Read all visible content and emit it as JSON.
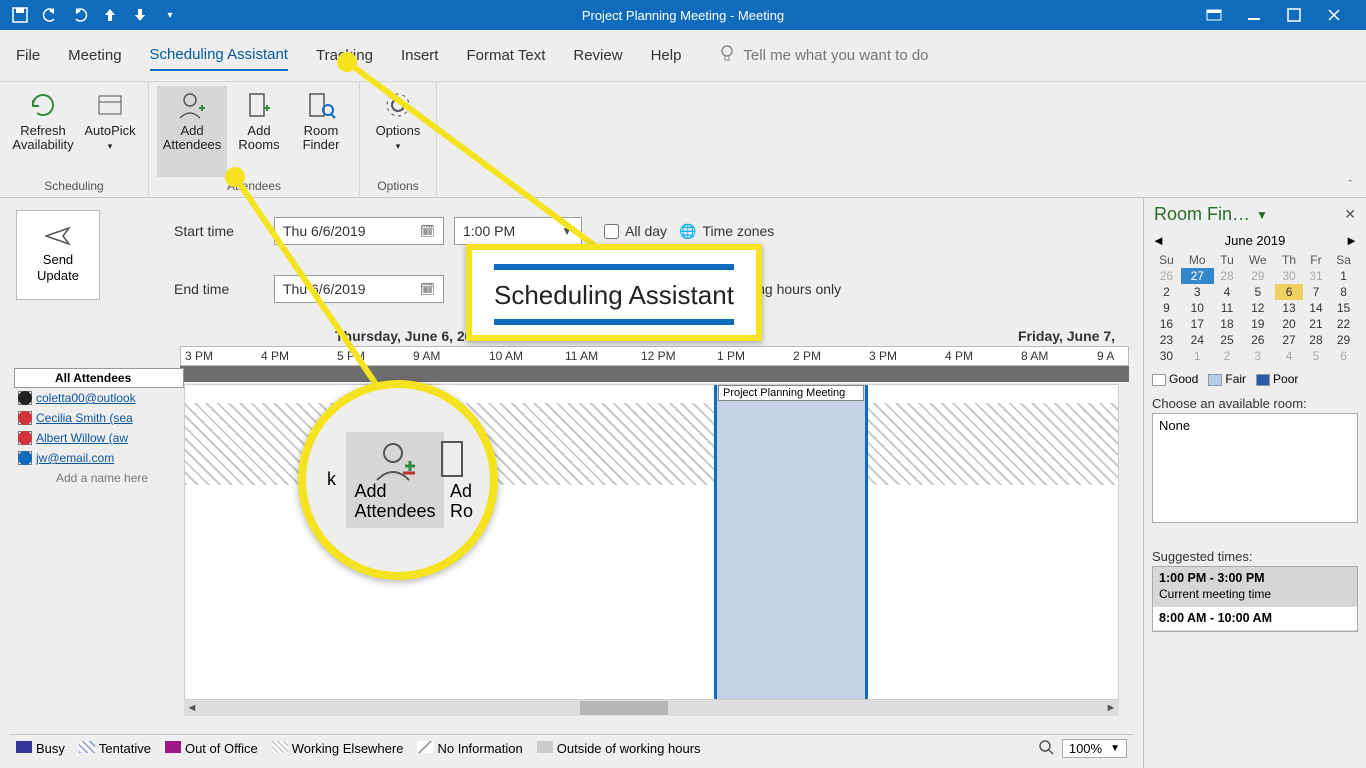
{
  "title_bar": {
    "title": "Project Planning Meeting  -  Meeting"
  },
  "tabs": {
    "file": "File",
    "meeting": "Meeting",
    "scheduling": "Scheduling Assistant",
    "tracking": "Tracking",
    "insert": "Insert",
    "format": "Format Text",
    "review": "Review",
    "help": "Help",
    "tellme": "Tell me what you want to do"
  },
  "ribbon": {
    "scheduling_group": "Scheduling",
    "attendees_group": "Attendees",
    "options_group": "Options",
    "refresh": "Refresh\nAvailability",
    "autopick": "AutoPick",
    "add_attendees": "Add\nAttendees",
    "add_rooms": "Add\nRooms",
    "room_finder": "Room\nFinder",
    "options": "Options"
  },
  "send_update": "Send\nUpdate",
  "time_form": {
    "start_label": "Start time",
    "end_label": "End time",
    "start_date": "Thu 6/6/2019",
    "end_date": "Thu 6/6/2019",
    "start_time": "1:00 PM",
    "all_day": "All day",
    "time_zones": "Time zones",
    "working_hours": "ing hours only"
  },
  "schedule": {
    "day1": "Thursday, June 6, 2019",
    "day2": "Friday, June 7,",
    "hours": [
      "3 PM",
      "4 PM",
      "5 PM",
      "9 AM",
      "10 AM",
      "11 AM",
      "12 PM",
      "1 PM",
      "2 PM",
      "3 PM",
      "4 PM",
      "8 AM",
      "9 A"
    ],
    "meeting_label": "Project Planning Meeting"
  },
  "attendees": {
    "header": "All Attendees",
    "add_hint": "Add a name here",
    "rows": [
      {
        "name": "coletta00@outlook",
        "color": "#222"
      },
      {
        "name": "Cecilia Smith (sea",
        "color": "#d13438"
      },
      {
        "name": "Albert Willow (aw",
        "color": "#d13438"
      },
      {
        "name": "jw@email.com",
        "color": "#0f6cbd"
      }
    ]
  },
  "legend": {
    "busy": "Busy",
    "tentative": "Tentative",
    "ooo": "Out of Office",
    "working_elsewhere": "Working Elsewhere",
    "no_info": "No Information",
    "outside": "Outside of working hours",
    "zoom": "100%"
  },
  "room_finder": {
    "title": "Room Fin…",
    "month": "June 2019",
    "dow": [
      "Su",
      "Mo",
      "Tu",
      "We",
      "Th",
      "Fr",
      "Sa"
    ],
    "weeks": [
      [
        "26",
        "27",
        "28",
        "29",
        "30",
        "31",
        "1"
      ],
      [
        "2",
        "3",
        "4",
        "5",
        "6",
        "7",
        "8"
      ],
      [
        "9",
        "10",
        "11",
        "12",
        "13",
        "14",
        "15"
      ],
      [
        "16",
        "17",
        "18",
        "19",
        "20",
        "21",
        "22"
      ],
      [
        "23",
        "24",
        "25",
        "26",
        "27",
        "28",
        "29"
      ],
      [
        "30",
        "1",
        "2",
        "3",
        "4",
        "5",
        "6"
      ]
    ],
    "good": "Good",
    "fair": "Fair",
    "poor": "Poor",
    "choose": "Choose an available room:",
    "none": "None",
    "suggested": "Suggested times:",
    "slot1_t": "1:00 PM - 3:00 PM",
    "slot1_s": "Current meeting time",
    "slot2_t": "8:00 AM - 10:00 AM"
  },
  "callouts": {
    "scheduling_assistant": "Scheduling Assistant",
    "add_attendees": "Add\nAttendees",
    "add_rooms_abbrev": "Ad\nRo",
    "k": "k"
  }
}
